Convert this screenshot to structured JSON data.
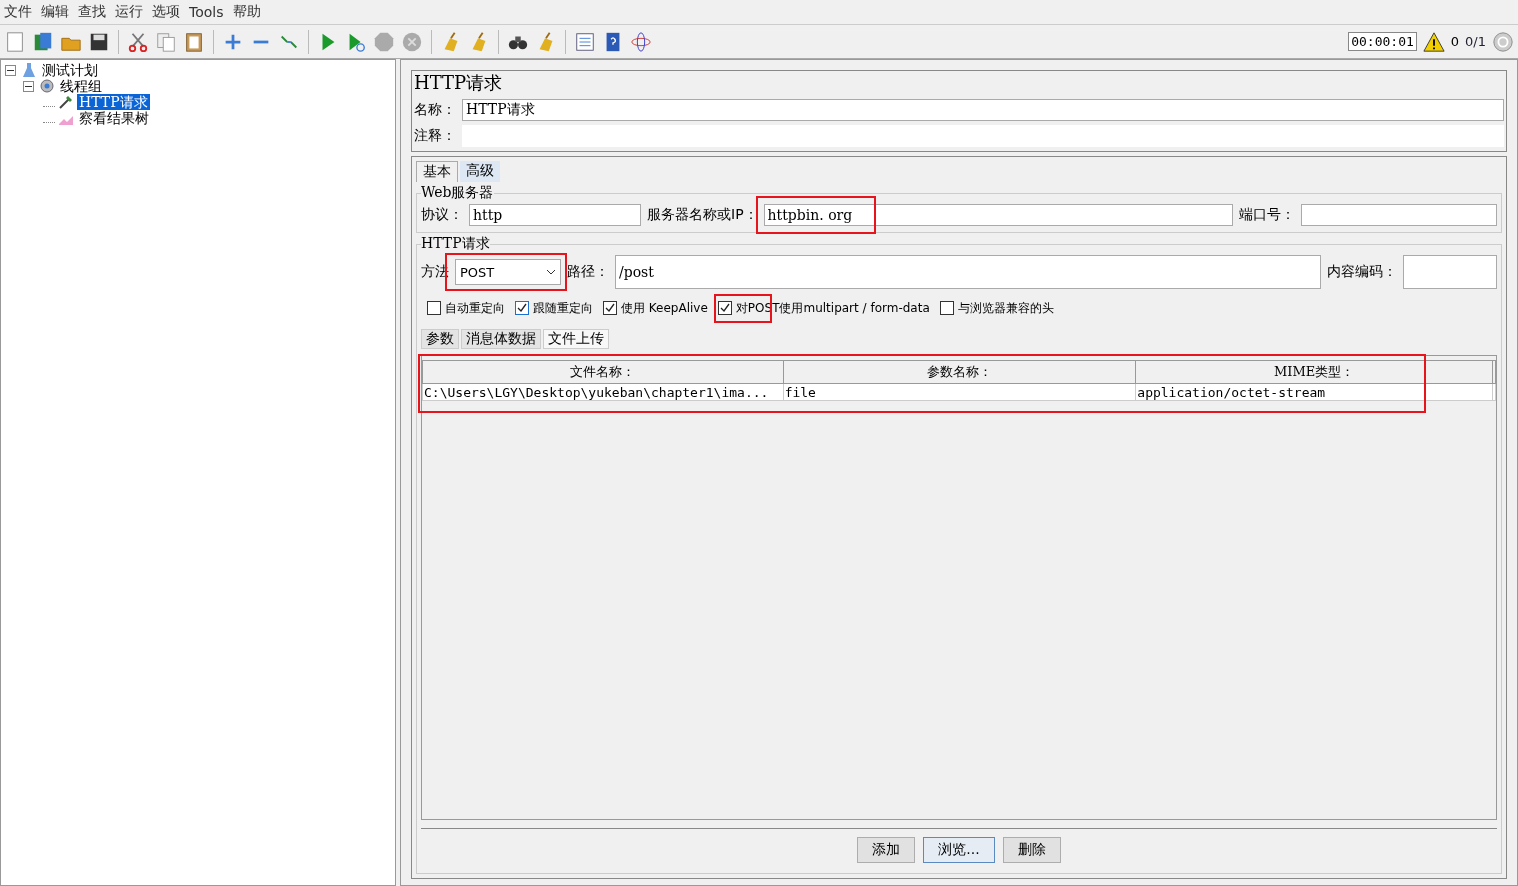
{
  "menu": [
    "文件",
    "编辑",
    "查找",
    "运行",
    "选项",
    "Tools",
    "帮助"
  ],
  "status": {
    "timer": "00:00:01",
    "warnings": "0",
    "threads": "0/1"
  },
  "tree": [
    {
      "label": "测试计划",
      "expanded": true,
      "selected": false,
      "children": [
        {
          "label": "线程组",
          "expanded": true,
          "selected": false,
          "children": [
            {
              "label": "HTTP请求",
              "selected": true
            },
            {
              "label": "察看结果树",
              "selected": false
            }
          ]
        }
      ]
    }
  ],
  "panel": {
    "title": "HTTP请求",
    "name_label": "名称：",
    "name_value": "HTTP请求",
    "comment_label": "注释：",
    "tabs": [
      {
        "label": "基本",
        "selected": true
      },
      {
        "label": "高级",
        "selected": false
      }
    ],
    "web_server": {
      "legend": "Web服务器",
      "protocol_label": "协议：",
      "protocol": "http",
      "server_label": "服务器名称或IP：",
      "server": "httpbin. org",
      "server_highlighted": true,
      "port_label": "端口号："
    },
    "http_request": {
      "legend": "HTTP请求",
      "method_label": "方法",
      "method": "POST",
      "method_highlighted": true,
      "path_label": "路径：",
      "path": "/post",
      "encoding_label": "内容编码：",
      "options": [
        {
          "label": "自动重定向",
          "checked": false,
          "highlighted": false
        },
        {
          "label": "跟随重定向",
          "checked": true,
          "highlighted": false
        },
        {
          "label": "使用 KeepAlive",
          "checked": true,
          "highlighted": false
        },
        {
          "label": "对POST使用multipart / form-data",
          "checked": true,
          "highlighted": true
        },
        {
          "label": "与浏览器兼容的头",
          "checked": false,
          "highlighted": false
        }
      ]
    },
    "sub_tabs": [
      {
        "label": "参数",
        "selected": false
      },
      {
        "label": "消息体数据",
        "selected": false
      },
      {
        "label": "文件上传",
        "selected": true
      }
    ],
    "table": {
      "highlighted": true,
      "columns": [
        "文件名称：",
        "参数名称：",
        "MIME类型："
      ],
      "rows": [
        [
          "C:\\Users\\LGY\\Desktop\\yukeban\\chapter1\\ima...",
          "file",
          "application/octet-stream"
        ]
      ]
    },
    "buttons": [
      "添加",
      "浏览...",
      "删除"
    ]
  }
}
